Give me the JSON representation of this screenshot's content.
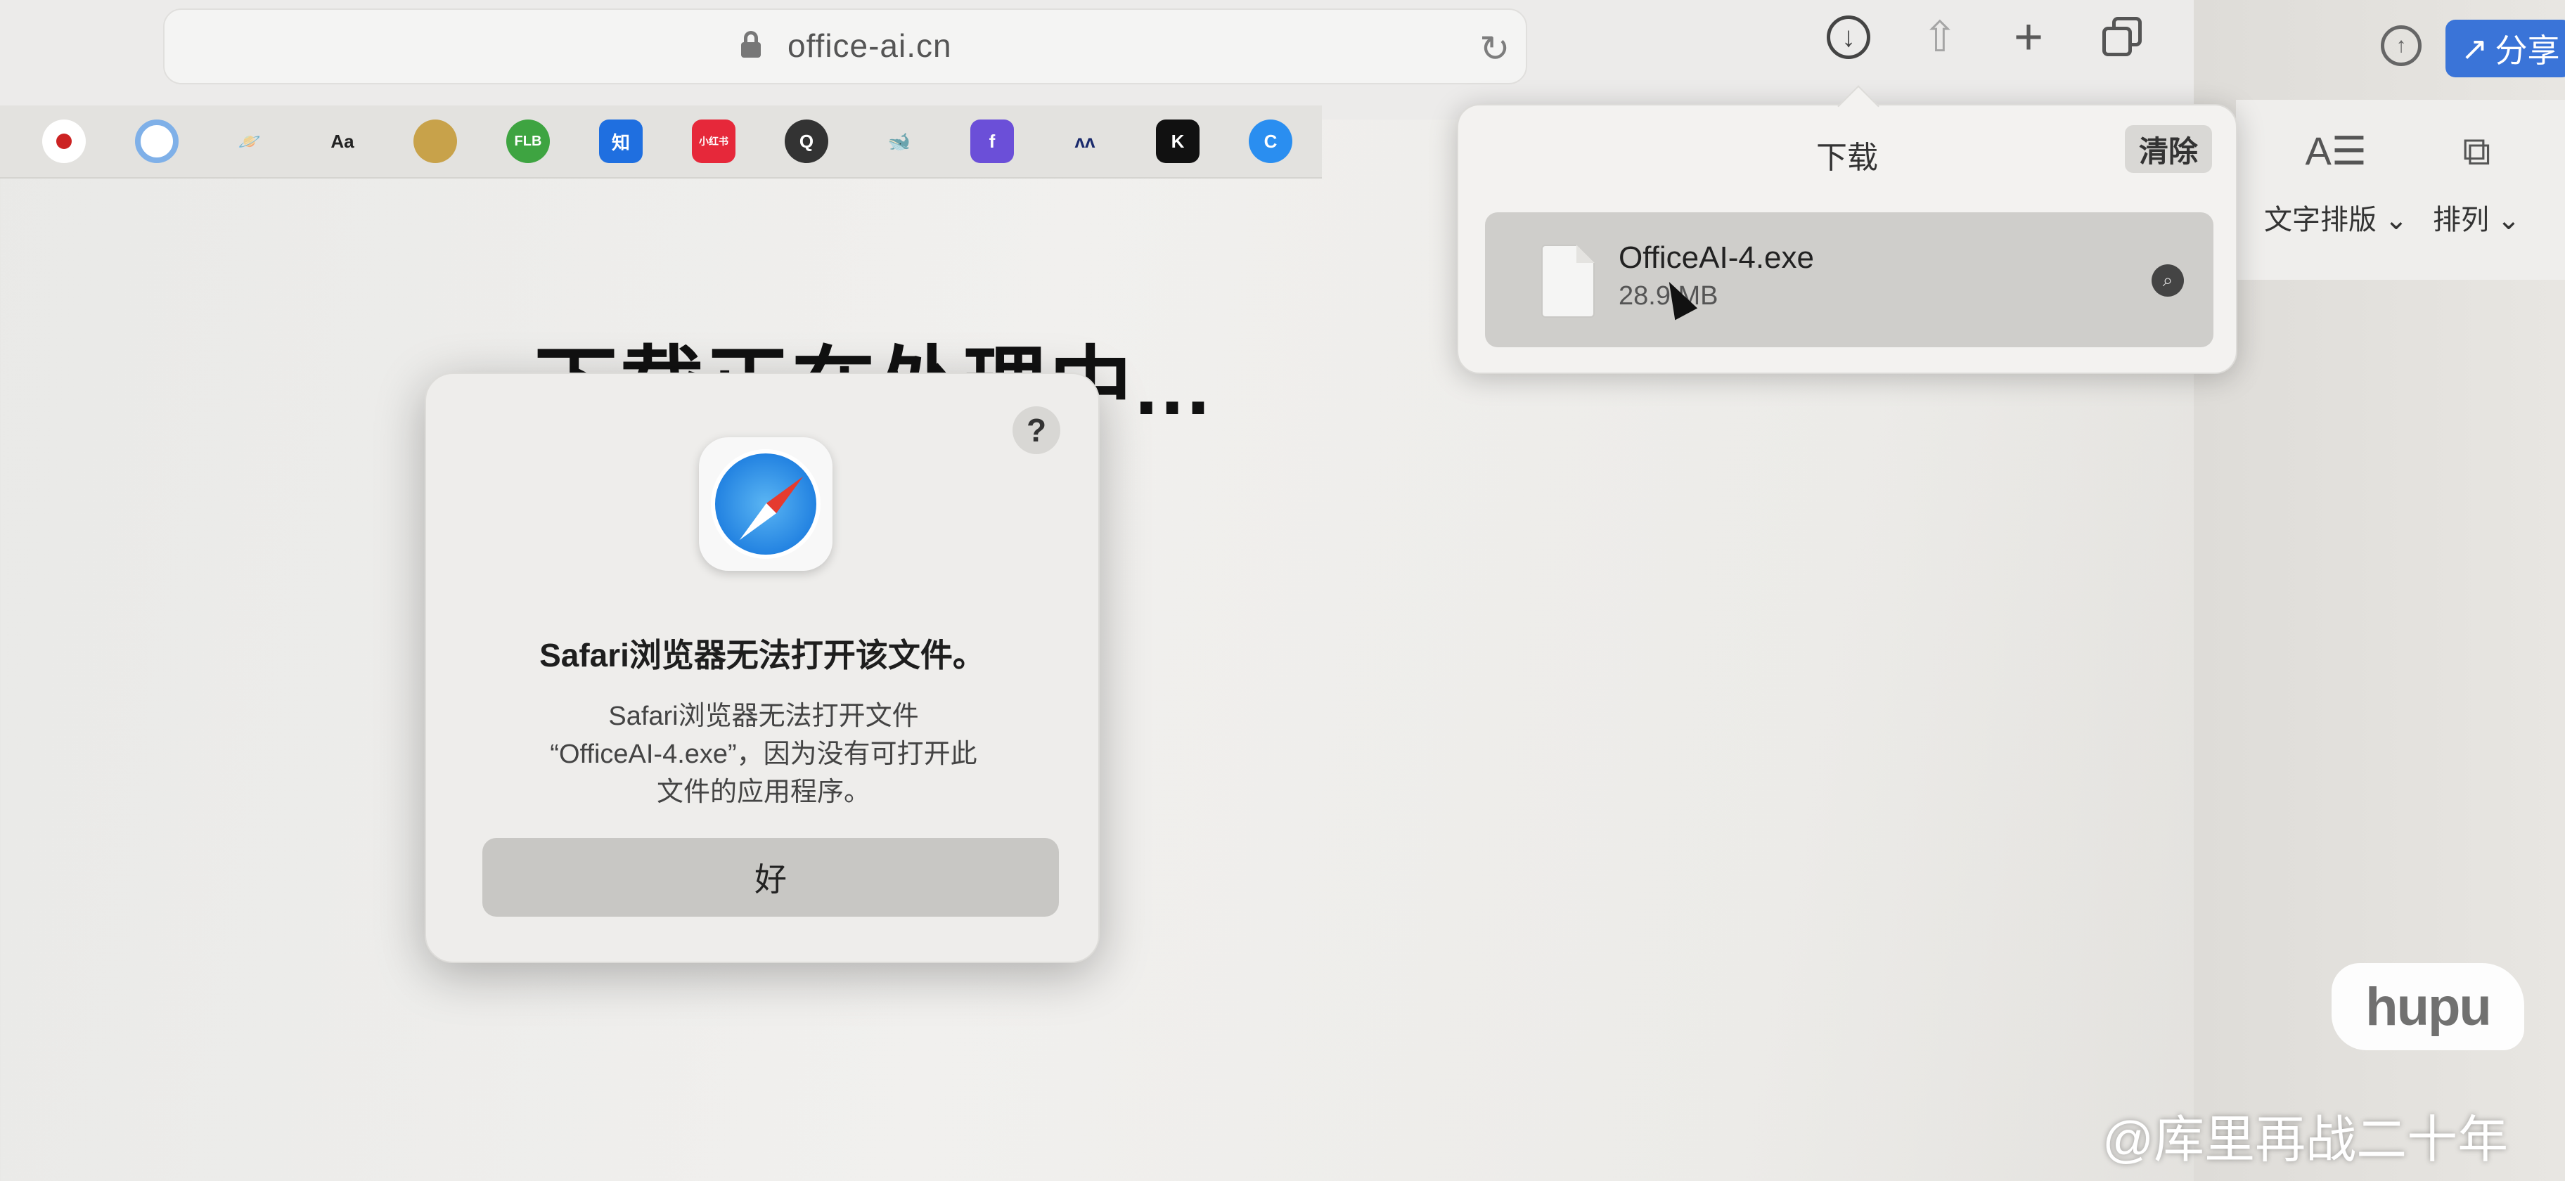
{
  "browser": {
    "url": "office-ai.cn",
    "reload_glyph": "↻",
    "download_glyph": "↓",
    "share_glyph": "⇧",
    "plus_glyph": "+",
    "icons": [
      "lock-icon",
      "reload-icon",
      "download-icon",
      "share-icon",
      "new-tab-icon",
      "tabs-overview-icon"
    ]
  },
  "favorites": [
    {
      "label": "",
      "color": "#ffffff",
      "fg": "#c22"
    },
    {
      "label": "",
      "color": "#ffffff",
      "fg": "#888"
    },
    {
      "label": "🪐",
      "color": "#e3e2df",
      "fg": "#3a3a8a"
    },
    {
      "label": "Aa",
      "color": "#e3e2df",
      "fg": "#222"
    },
    {
      "label": "",
      "color": "#c8a24a",
      "fg": "#fff"
    },
    {
      "label": "FLB",
      "color": "#3ea441",
      "fg": "#fff"
    },
    {
      "label": "知",
      "color": "#1f6fe0",
      "fg": "#fff"
    },
    {
      "label": "小红书",
      "color": "#e6283a",
      "fg": "#fff"
    },
    {
      "label": "Q",
      "color": "#333333",
      "fg": "#fff"
    },
    {
      "label": "🐋",
      "color": "#e3e2df",
      "fg": "#1f4fd0"
    },
    {
      "label": "f",
      "color": "#6b4fd8",
      "fg": "#fff"
    },
    {
      "label": "ʌʌ",
      "color": "#e3e2df",
      "fg": "#1a2a6c"
    },
    {
      "label": "K",
      "color": "#111111",
      "fg": "#fff"
    },
    {
      "label": "C",
      "color": "#2a8ef0",
      "fg": "#fff"
    }
  ],
  "app": {
    "share_label": "分享",
    "ribbon": [
      {
        "glyph": "A☰",
        "label": "文字排版 ⌄"
      },
      {
        "glyph": "⧉",
        "label": "排列 ⌄"
      }
    ]
  },
  "page": {
    "heading": "下载正在处理中..."
  },
  "downloads": {
    "title": "下载",
    "clear_label": "清除",
    "item": {
      "file_name": "OfficeAI-4.exe",
      "size": "28.9 MB"
    }
  },
  "alert": {
    "help_label": "?",
    "title": "Safari浏览器无法打开该文件。",
    "message_lines": [
      "Safari浏览器无法打开文件",
      "“OfficeAI-4.exe”，因为没有可打开此",
      "文件的应用程序。"
    ],
    "ok_label": "好"
  },
  "watermark": {
    "logo_text": "hupu",
    "credit": "@库里再战二十年"
  }
}
